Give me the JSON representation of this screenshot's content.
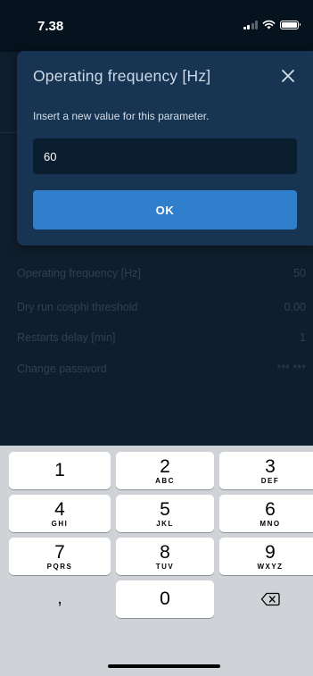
{
  "status_bar": {
    "time": "7.38",
    "icons": [
      "signal-icon",
      "wifi-icon",
      "battery-icon"
    ]
  },
  "background_list": [
    {
      "label": "Operating frequency [Hz]",
      "value": "50"
    },
    {
      "label": "Dry run cosphi threshold",
      "value": "0.00"
    },
    {
      "label": "Restarts delay [min]",
      "value": "1"
    },
    {
      "label": "Change password",
      "value": "*** ***"
    }
  ],
  "dialog": {
    "title": "Operating frequency [Hz]",
    "subtitle": "Insert a new value for this parameter.",
    "input_value": "60",
    "ok_label": "OK",
    "close_icon": "close-icon"
  },
  "keypad": {
    "keys": [
      {
        "digit": "1",
        "letters": ""
      },
      {
        "digit": "2",
        "letters": "ABC"
      },
      {
        "digit": "3",
        "letters": "DEF"
      },
      {
        "digit": "4",
        "letters": "GHI"
      },
      {
        "digit": "5",
        "letters": "JKL"
      },
      {
        "digit": "6",
        "letters": "MNO"
      },
      {
        "digit": "7",
        "letters": "PQRS"
      },
      {
        "digit": "8",
        "letters": "TUV"
      },
      {
        "digit": "9",
        "letters": "WXYZ"
      },
      {
        "digit": ",",
        "letters": ""
      },
      {
        "digit": "0",
        "letters": ""
      }
    ],
    "backspace_icon": "backspace-icon"
  },
  "colors": {
    "dialog_bg": "#173552",
    "accent": "#2f7fcd",
    "app_bg": "#0c1a28",
    "keyboard_bg": "#cfd2d7"
  }
}
